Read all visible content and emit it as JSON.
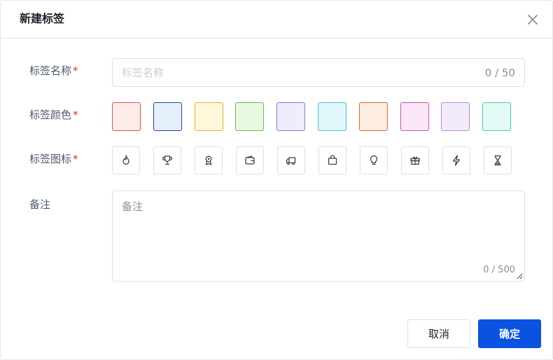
{
  "dialog": {
    "title": "新建标签",
    "close_icon": "close-icon"
  },
  "form": {
    "name": {
      "label": "标签名称",
      "required_mark": "*",
      "placeholder": "标签名称",
      "value": "",
      "counter": "0 / 50"
    },
    "color": {
      "label": "标签颜色",
      "required_mark": "*",
      "options": [
        {
          "name": "red",
          "fill": "#fdecea",
          "border": "#d9534f"
        },
        {
          "name": "blue",
          "fill": "#e6f0fd",
          "border": "#1e4b99"
        },
        {
          "name": "yellow",
          "fill": "#fef7dc",
          "border": "#e6b422"
        },
        {
          "name": "green",
          "fill": "#e9f9e1",
          "border": "#67b94a"
        },
        {
          "name": "indigo",
          "fill": "#eeecfd",
          "border": "#8878d8"
        },
        {
          "name": "cyan",
          "fill": "#e0f7fa",
          "border": "#3fc4d4"
        },
        {
          "name": "orange",
          "fill": "#fdece0",
          "border": "#d86b33"
        },
        {
          "name": "pink",
          "fill": "#fbe7f5",
          "border": "#c653b0"
        },
        {
          "name": "purple",
          "fill": "#f3eafc",
          "border": "#b28be2"
        },
        {
          "name": "teal",
          "fill": "#e3fbf4",
          "border": "#3ad1b4"
        }
      ]
    },
    "icon": {
      "label": "标签图标",
      "required_mark": "*",
      "options": [
        "flame-icon",
        "trophy-icon",
        "award-icon",
        "wallet-icon",
        "truck-icon",
        "shopping-bag-icon",
        "lightbulb-icon",
        "gift-icon",
        "lightning-icon",
        "hourglass-icon"
      ]
    },
    "note": {
      "label": "备注",
      "placeholder": "备注",
      "value": "",
      "counter": "0 / 500"
    }
  },
  "footer": {
    "cancel_label": "取消",
    "ok_label": "确定"
  }
}
